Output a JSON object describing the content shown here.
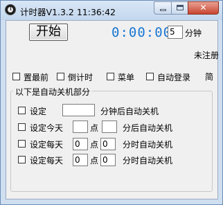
{
  "window": {
    "title": "计时器V1.3.2 11:36:42"
  },
  "controls": {
    "start_label": "开始",
    "timer_display": "0:00:00",
    "minutes_value": "5",
    "minutes_unit": "分钟",
    "register_status": "未注册",
    "lang_link": "简"
  },
  "options": [
    {
      "label": "置最前",
      "checked": false
    },
    {
      "label": "倒计时",
      "checked": false
    },
    {
      "label": "菜单",
      "checked": false
    },
    {
      "label": "自动登录",
      "checked": false
    }
  ],
  "shutdown": {
    "group_title": "以下是自动关机部分",
    "rows": [
      {
        "checkbox_label": "设定",
        "minutes_value": "",
        "suffix": "分钟后自动关机"
      },
      {
        "checkbox_label": "设定今天",
        "hour_value": "",
        "point_label": "点",
        "minute_value": "",
        "suffix": "分后自动关机"
      },
      {
        "checkbox_label": "设定每天",
        "hour_value": "0",
        "point_label": "点",
        "minute_value": "0",
        "suffix": "分时自动关机"
      },
      {
        "checkbox_label": "设定每天",
        "hour_value": "0",
        "point_label": "点",
        "minute_value": "0",
        "suffix": "分时自动关机"
      }
    ]
  },
  "colors": {
    "timer": "#1976d2",
    "frame": "#cfdff0",
    "close_button": "#c84531"
  }
}
